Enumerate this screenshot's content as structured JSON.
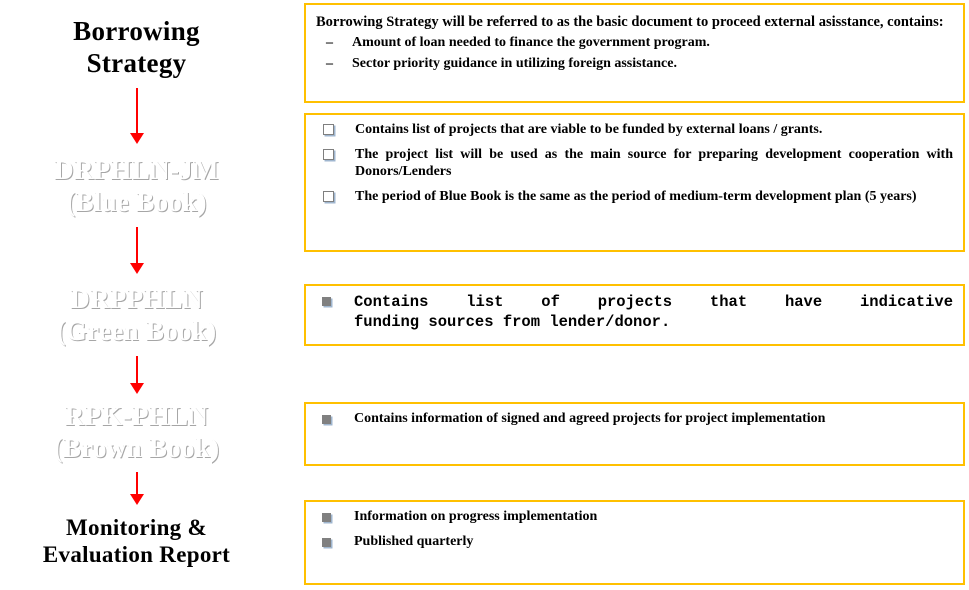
{
  "colors": {
    "strategy_fill": "#BFBFBF",
    "blue_fill": "#0000FF",
    "green_fill": "#008A00",
    "brown_fill": "#6B3410",
    "purple_fill": "#CC99FF",
    "note_border": "#FFC000",
    "arrow": "#FF0000"
  },
  "flow": {
    "nodes": [
      {
        "id": "borrowing-strategy",
        "line1": "Borrowing",
        "line2": "Strategy"
      },
      {
        "id": "drphln-jm",
        "line1": "DRPHLN-JM",
        "line2": "(Blue Book)"
      },
      {
        "id": "drpphln",
        "line1": "DRPPHLN",
        "line2": "(Green Book)"
      },
      {
        "id": "rpk-phln",
        "line1": "RPK-PHLN",
        "line2": "(Brown Book)"
      },
      {
        "id": "monitoring-evaluation-report",
        "line1": "Monitoring &",
        "line2": "Evaluation Report"
      }
    ]
  },
  "notes": [
    {
      "id": "note-borrowing-strategy",
      "bullet_style": "dash",
      "lead": "Borrowing Strategy  will be referred  to as the basic document to proceed external asisstance, contains:",
      "items": [
        "Amount of loan needed to finance the government program.",
        "Sector priority guidance in utilizing foreign assistance."
      ]
    },
    {
      "id": "note-blue-book",
      "bullet_style": "hollow-square",
      "lead": "",
      "items": [
        "Contains list of projects that are viable to be funded  by external loans / grants.",
        "The project list will be used as the main source for preparing development cooperation with Donors/Lenders",
        "The period of Blue Book is the same as the period of medium-term development plan (5 years)"
      ]
    },
    {
      "id": "note-green-book",
      "bullet_style": "filled-square-mono",
      "lead": "",
      "items": [
        "Contains list of projects that have indicative",
        "funding sources from lender/donor."
      ]
    },
    {
      "id": "note-brown-book",
      "bullet_style": "filled-square",
      "lead": "",
      "items": [
        "Contains  information of signed and agreed projects for project implementation"
      ]
    },
    {
      "id": "note-monitoring-evaluation",
      "bullet_style": "filled-square",
      "lead": "",
      "items": [
        "Information on progress implementation",
        "Published quarterly"
      ]
    }
  ]
}
